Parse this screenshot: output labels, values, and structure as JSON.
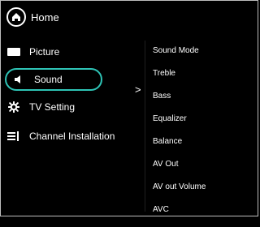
{
  "header": {
    "title": "Home",
    "icon": "home-icon"
  },
  "left_menu": [
    {
      "label": "Picture",
      "icon": "picture-icon"
    },
    {
      "label": "Sound",
      "icon": "speaker-icon",
      "selected": true
    },
    {
      "label": "TV Setting",
      "icon": "gear-icon"
    },
    {
      "label": "Channel Installation",
      "icon": "channel-list-icon"
    }
  ],
  "submenu_arrow": ">",
  "right_menu": [
    "Sound Mode",
    "Treble",
    "Bass",
    "Equalizer",
    "Balance",
    "AV Out",
    "AV out Volume",
    "AVC"
  ],
  "colors": {
    "background": "#000000",
    "accent": "#2ec4b6",
    "text": "#ffffff"
  }
}
